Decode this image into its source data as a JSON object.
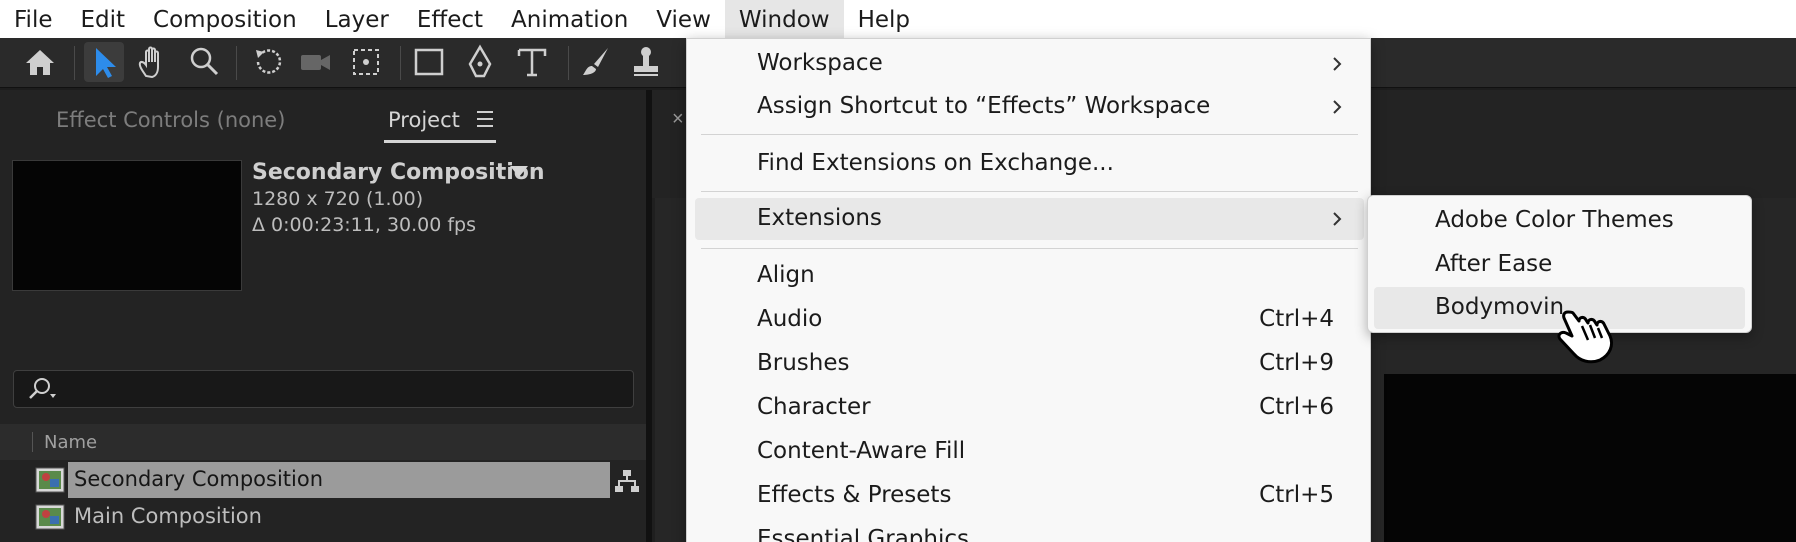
{
  "menubar": {
    "items": [
      "File",
      "Edit",
      "Composition",
      "Layer",
      "Effect",
      "Animation",
      "View",
      "Window",
      "Help"
    ],
    "active": "Window"
  },
  "toolbar": {
    "tools": [
      "home-icon",
      "selection-tool-icon",
      "hand-tool-icon",
      "zoom-tool-icon",
      "rotate-tool-icon",
      "camera-tool-icon",
      "anchor-point-tool-icon",
      "rectangle-tool-icon",
      "pen-tool-icon",
      "type-tool-icon",
      "brush-tool-icon",
      "clone-stamp-tool-icon"
    ]
  },
  "left_panel": {
    "tab_effect_controls": "Effect Controls (none)",
    "tab_project": "Project",
    "composition_name": "Secondary Composition",
    "composition_size": "1280 x 720 (1.00)",
    "composition_duration": "Δ 0:00:23:11, 30.00 fps",
    "column_name": "Name",
    "items": [
      {
        "label": "Secondary Composition",
        "selected": true
      },
      {
        "label": "Main Composition",
        "selected": false
      }
    ]
  },
  "right_panel": {
    "close_glyph": "×"
  },
  "window_menu": {
    "items": [
      {
        "label": "Workspace",
        "submenu": true
      },
      {
        "label": "Assign Shortcut to “Effects” Workspace",
        "submenu": true
      },
      {
        "label": "Find Extensions on Exchange...",
        "submenu": false
      },
      {
        "label": "Extensions",
        "submenu": true,
        "highlighted": true
      },
      {
        "label": "Align",
        "shortcut": ""
      },
      {
        "label": "Audio",
        "shortcut": "Ctrl+4"
      },
      {
        "label": "Brushes",
        "shortcut": "Ctrl+9"
      },
      {
        "label": "Character",
        "shortcut": "Ctrl+6"
      },
      {
        "label": "Content-Aware Fill",
        "shortcut": ""
      },
      {
        "label": "Effects & Presets",
        "shortcut": "Ctrl+5"
      },
      {
        "label": "Essential Graphics",
        "shortcut": ""
      }
    ]
  },
  "extensions_submenu": {
    "items": [
      {
        "label": "Adobe Color Themes"
      },
      {
        "label": "After Ease"
      },
      {
        "label": "Bodymovin",
        "highlighted": true
      }
    ]
  },
  "colors": {
    "menubar_bg": "#ffffff",
    "menu_bg": "#f8f8f8",
    "menu_highlight": "#e8e8e8",
    "panel_bg": "#232323",
    "selection_tool_accent": "#2d8ceb"
  }
}
